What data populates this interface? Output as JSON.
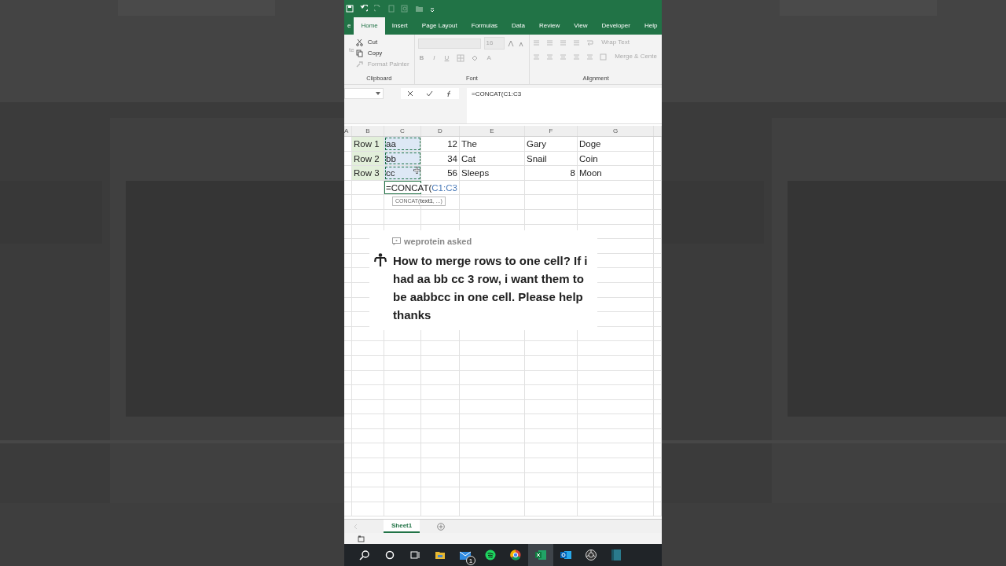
{
  "ribbon_tabs": [
    {
      "label": "e",
      "selected": false
    },
    {
      "label": "Home",
      "selected": true
    },
    {
      "label": "Insert",
      "selected": false
    },
    {
      "label": "Page Layout",
      "selected": false
    },
    {
      "label": "Formulas",
      "selected": false
    },
    {
      "label": "Data",
      "selected": false
    },
    {
      "label": "Review",
      "selected": false
    },
    {
      "label": "View",
      "selected": false
    },
    {
      "label": "Developer",
      "selected": false
    },
    {
      "label": "Help",
      "selected": false
    }
  ],
  "ribbon": {
    "clipboard": {
      "paste": "te",
      "cut": "Cut",
      "copy": "Copy",
      "format_painter": "Format Painter",
      "label": "Clipboard"
    },
    "font": {
      "size": "16",
      "bold": "B",
      "italic": "I",
      "underline": "U",
      "font_color": "A",
      "label": "Font"
    },
    "alignment": {
      "wrap_text": "Wrap Text",
      "merge": "Merge & Cente",
      "label": "Alignment"
    }
  },
  "formula_bar": {
    "formula": "=CONCAT(C1:C3"
  },
  "columns": [
    "A",
    "B",
    "C",
    "D",
    "E",
    "F",
    "G"
  ],
  "rows": [
    {
      "cells": [
        {
          "kind": "empty"
        },
        {
          "text": "Row 1",
          "kind": "label"
        },
        {
          "text": "aa",
          "kind": "text",
          "selected": true
        },
        {
          "text": "12",
          "kind": "number"
        },
        {
          "text": "The",
          "kind": "text"
        },
        {
          "text": "Gary",
          "kind": "text"
        },
        {
          "text": "Doge",
          "kind": "text"
        }
      ]
    },
    {
      "cells": [
        {
          "kind": "empty"
        },
        {
          "text": "Row 2",
          "kind": "label"
        },
        {
          "text": "bb",
          "kind": "text",
          "selected": true
        },
        {
          "text": "34",
          "kind": "number"
        },
        {
          "text": "Cat",
          "kind": "text"
        },
        {
          "text": "Snail",
          "kind": "text"
        },
        {
          "text": "Coin",
          "kind": "text"
        }
      ]
    },
    {
      "cells": [
        {
          "kind": "empty"
        },
        {
          "text": "Row 3",
          "kind": "label"
        },
        {
          "text": "cc",
          "kind": "text",
          "selected": true
        },
        {
          "text": "56",
          "kind": "number"
        },
        {
          "text": "Sleeps",
          "kind": "text"
        },
        {
          "text": "8",
          "kind": "number"
        },
        {
          "text": "Moon",
          "kind": "text"
        }
      ]
    },
    {
      "cells": [
        {
          "kind": "empty"
        },
        {
          "kind": "empty"
        },
        {
          "kind": "formula",
          "text": "=CONCAT(",
          "reference": "C1:C3",
          "tooltip": "CONCAT(**text1**, ...)"
        }
      ]
    }
  ],
  "question": {
    "asker": "weprotein asked",
    "text": "How to merge rows to one cell? If i had aa bb cc 3 row, i want them to be aabbcc in one cell. Please help thanks"
  },
  "sheet_tabs": [
    {
      "label": "Sheet1",
      "selected": true
    }
  ],
  "taskbar": [
    {
      "kind": "search",
      "selected": false
    },
    {
      "kind": "circle",
      "selected": false
    },
    {
      "kind": "taskview",
      "selected": false
    },
    {
      "kind": "folder",
      "selected": false
    },
    {
      "kind": "mail",
      "badge": "1",
      "selected": false
    },
    {
      "kind": "music",
      "selected": false
    },
    {
      "kind": "browser",
      "selected": false
    },
    {
      "kind": "sheet",
      "selected": true
    },
    {
      "kind": "outlook",
      "selected": false
    },
    {
      "kind": "aperture",
      "selected": false
    },
    {
      "kind": "panel",
      "selected": false
    }
  ]
}
